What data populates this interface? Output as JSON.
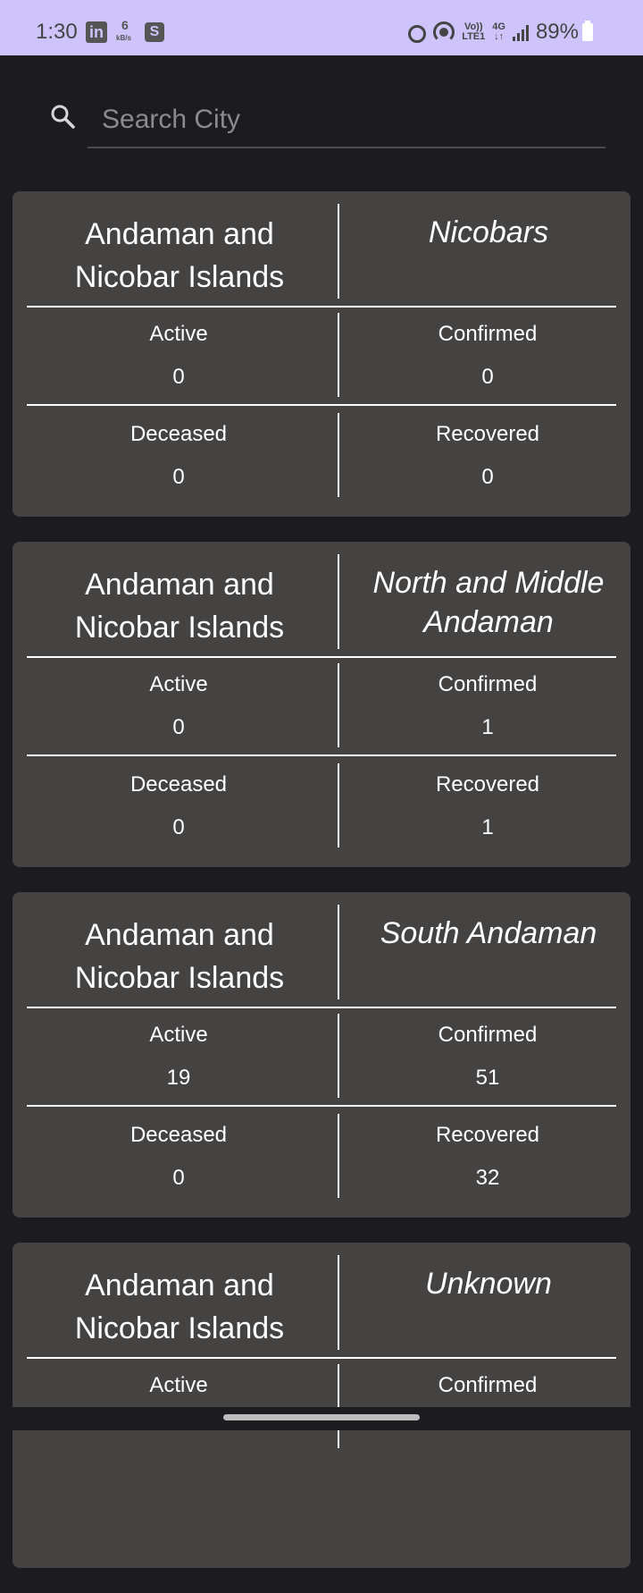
{
  "status_bar": {
    "time": "1:30",
    "netspeed_value": "6",
    "netspeed_unit": "kB/s",
    "volte_top": "Vo))",
    "volte_bottom": "LTE1",
    "network_type": "4G",
    "battery": "89%",
    "icons": [
      "linkedin-icon",
      "s-app-icon",
      "alarm-icon",
      "hotspot-icon",
      "volte-icon",
      "signal-icon",
      "battery-icon"
    ]
  },
  "search": {
    "placeholder": "Search City",
    "value": ""
  },
  "labels": {
    "active": "Active",
    "confirmed": "Confirmed",
    "deceased": "Deceased",
    "recovered": "Recovered"
  },
  "cards": [
    {
      "state_line1": "Andaman and",
      "state_line2": "Nicobar Islands",
      "district_line1": "Nicobars",
      "district_line2": "",
      "active": "0",
      "confirmed": "0",
      "deceased": "0",
      "recovered": "0"
    },
    {
      "state_line1": "Andaman and",
      "state_line2": "Nicobar Islands",
      "district_line1": "North and Middle",
      "district_line2": "Andaman",
      "active": "0",
      "confirmed": "1",
      "deceased": "0",
      "recovered": "1"
    },
    {
      "state_line1": "Andaman and",
      "state_line2": "Nicobar Islands",
      "district_line1": "South Andaman",
      "district_line2": "",
      "active": "19",
      "confirmed": "51",
      "deceased": "0",
      "recovered": "32"
    },
    {
      "state_line1": "Andaman and",
      "state_line2": "Nicobar Islands",
      "district_line1": "Unknown",
      "district_line2": "",
      "active": "",
      "confirmed": "",
      "deceased": "",
      "recovered": ""
    }
  ],
  "colors": {
    "background": "#1c1b1f",
    "status_bar": "#cfc3fb",
    "card": "#454242",
    "text": "#ffffff",
    "placeholder": "#8c8a90"
  }
}
